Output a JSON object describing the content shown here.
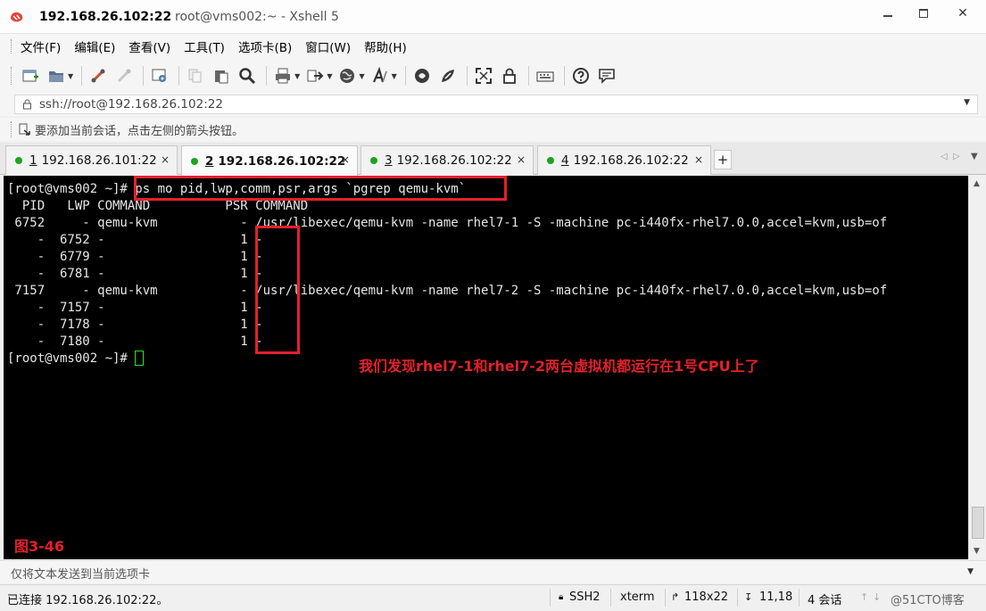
{
  "window": {
    "title_host": "192.168.26.102:22",
    "title_rest": "root@vms002:~ - Xshell 5"
  },
  "menu": {
    "items": [
      "文件(F)",
      "编辑(E)",
      "查看(V)",
      "工具(T)",
      "选项卡(B)",
      "窗口(W)",
      "帮助(H)"
    ]
  },
  "address": {
    "value": "ssh://root@192.168.26.102:22"
  },
  "hint": {
    "text": "要添加当前会话，点击左侧的箭头按钮。"
  },
  "tabs": [
    {
      "num": "1",
      "label": "192.168.26.101:22",
      "close": "×"
    },
    {
      "num": "2",
      "label": "192.168.26.102:22",
      "close": "×"
    },
    {
      "num": "3",
      "label": "192.168.26.102:22",
      "close": "×"
    },
    {
      "num": "4",
      "label": "192.168.26.102:22",
      "close": "×"
    }
  ],
  "tab_add": "+",
  "terminal": {
    "lines": [
      "[root@vms002 ~]# ps mo pid,lwp,comm,psr,args `pgrep qemu-kvm`",
      "  PID   LWP COMMAND          PSR COMMAND",
      " 6752     - qemu-kvm           - /usr/libexec/qemu-kvm -name rhel7-1 -S -machine pc-i440fx-rhel7.0.0,accel=kvm,usb=of",
      "    -  6752 -                  1 -",
      "    -  6779 -                  1 -",
      "    -  6781 -                  1 -",
      " 7157     - qemu-kvm           - /usr/libexec/qemu-kvm -name rhel7-2 -S -machine pc-i440fx-rhel7.0.0,accel=kvm,usb=of",
      "    -  7157 -                  1 -",
      "    -  7178 -                  1 -",
      "    -  7180 -                  1 -",
      "[root@vms002 ~]# "
    ],
    "annotation": "我们发现rhel7-1和rhel7-2两台虚拟机都运行在1号CPU上了",
    "figure_label": "图3-46"
  },
  "compose": {
    "placeholder": "仅将文本发送到当前选项卡"
  },
  "status": {
    "connection": "已连接 192.168.26.102:22。",
    "protocol": "SSH2",
    "terminal_type": "xterm",
    "size": "118x22",
    "cursor_pos": "11,18",
    "sessions": "4 会话",
    "watermark": "@51CTO博客"
  },
  "colors": {
    "highlight": "#e5202a",
    "session_dot": "#1fa21f",
    "cursor": "#2ee02e"
  }
}
